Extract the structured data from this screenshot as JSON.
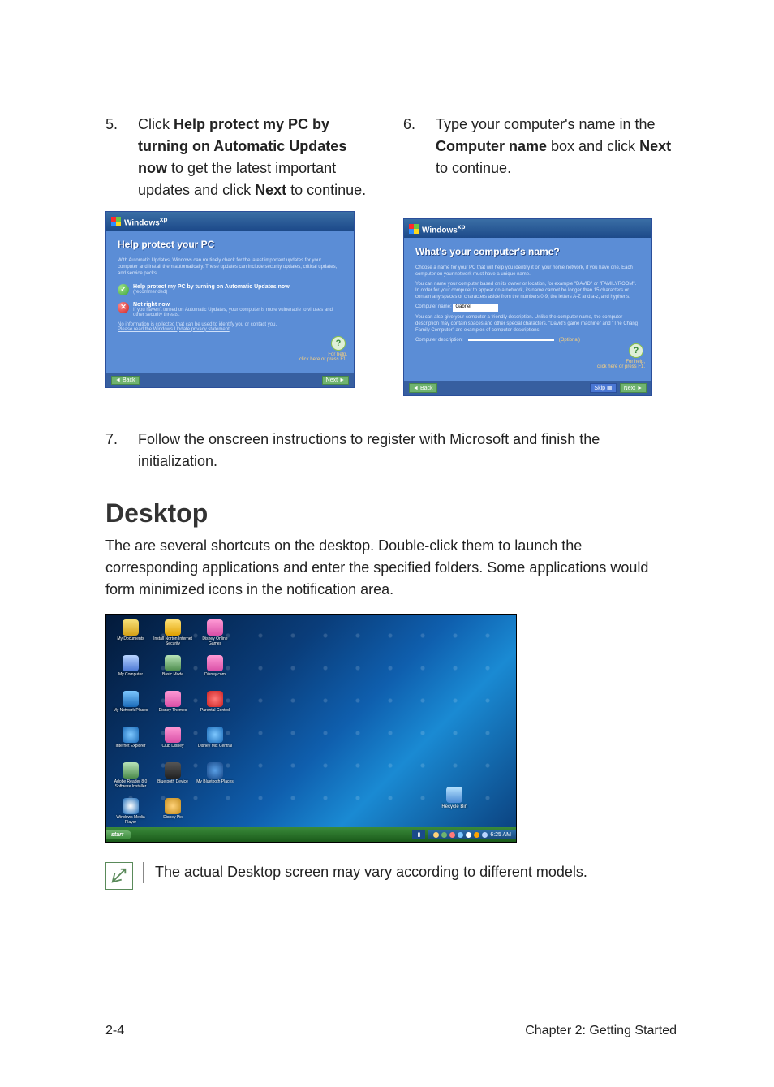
{
  "steps": {
    "s5": {
      "num": "5.",
      "pre": "Click ",
      "bold": "Help protect my PC by turning on Automatic Updates now",
      "mid": " to get the latest important updates and click ",
      "bold2": "Next",
      "post": " to continue."
    },
    "s6": {
      "num": "6.",
      "pre": "Type your computer's name in the ",
      "bold": "Computer name",
      "mid": " box and click ",
      "bold2": "Next",
      "post": " to continue."
    },
    "s7": {
      "num": "7.",
      "text": "Follow the onscreen instructions to register with Microsoft and finish the initialization."
    }
  },
  "xp": {
    "brand": "Windows",
    "brand_sup": "xp",
    "card1": {
      "heading": "Help protect your PC",
      "intro": "With Automatic Updates, Windows can routinely check for the latest important updates for your computer and install them automatically. These updates can include security updates, critical updates, and service packs.",
      "opt1_title": "Help protect my PC by turning on Automatic Updates now",
      "opt1_sub": "(recommended)",
      "opt2_title": "Not right now",
      "opt2_sub": "If you haven't turned on Automatic Updates, your computer is more vulnerable to viruses and other security threats.",
      "fine1": "No information is collected that can be used to identify you or contact you.",
      "fine2": "Please read the Windows Update privacy statement",
      "help_label1": "For help,",
      "help_label2": "click here or press F1.",
      "back": "Back",
      "next": "Next"
    },
    "card2": {
      "heading": "What's your computer's name?",
      "intro": "Choose a name for your PC that will help you identify it on your home network, if you have one. Each computer on your network must have a unique name.",
      "hint": "You can name your computer based on its owner or location, for example \"DAVID\" or \"FAMILYROOM\". In order for your computer to appear on a network, its name cannot be longer than 15 characters or contain any spaces or characters aside from the numbers 0-9, the letters A-Z and a-z, and hyphens.",
      "label_name": "Computer name:",
      "value_name": "Gabriel",
      "desc_intro": "You can also give your computer a friendly description. Unlike the computer name, the computer description may contain spaces and other special characters. \"David's game machine\" and \"The Chang Family Computer\" are examples of computer descriptions.",
      "label_desc": "Computer description:",
      "optional": "(Optional)",
      "back": "Back",
      "skip": "Skip",
      "next": "Next",
      "help_label1": "For help,",
      "help_label2": "click here or press F1."
    }
  },
  "section": {
    "title": "Desktop",
    "para": "The are several shortcuts on the desktop. Double-click them to launch the corresponding applications and enter the specified folders. Some applications would form minimized icons in the notification area."
  },
  "desktop": {
    "icons": [
      "My Documents",
      "Install Norton Internet Security",
      "Disney Online Games",
      "My Computer",
      "Basic Mode",
      "Disney.com",
      "My Network Places",
      "Disney Themes",
      "Parental Control",
      "Internet Explorer",
      "Club Disney",
      "Disney Mix Central",
      "Adobe Reader 8.0 Software Installer",
      "Bluetooth Device",
      "My Bluetooth Places",
      "Windows Media Player",
      "Disney Pix"
    ],
    "recycle": "Recycle Bin",
    "start": "start",
    "clock": "6:25 AM"
  },
  "note": {
    "text": "The actual Desktop screen may vary according to different models."
  },
  "footer": {
    "page": "2-4",
    "chapter": "Chapter 2: Getting Started"
  }
}
